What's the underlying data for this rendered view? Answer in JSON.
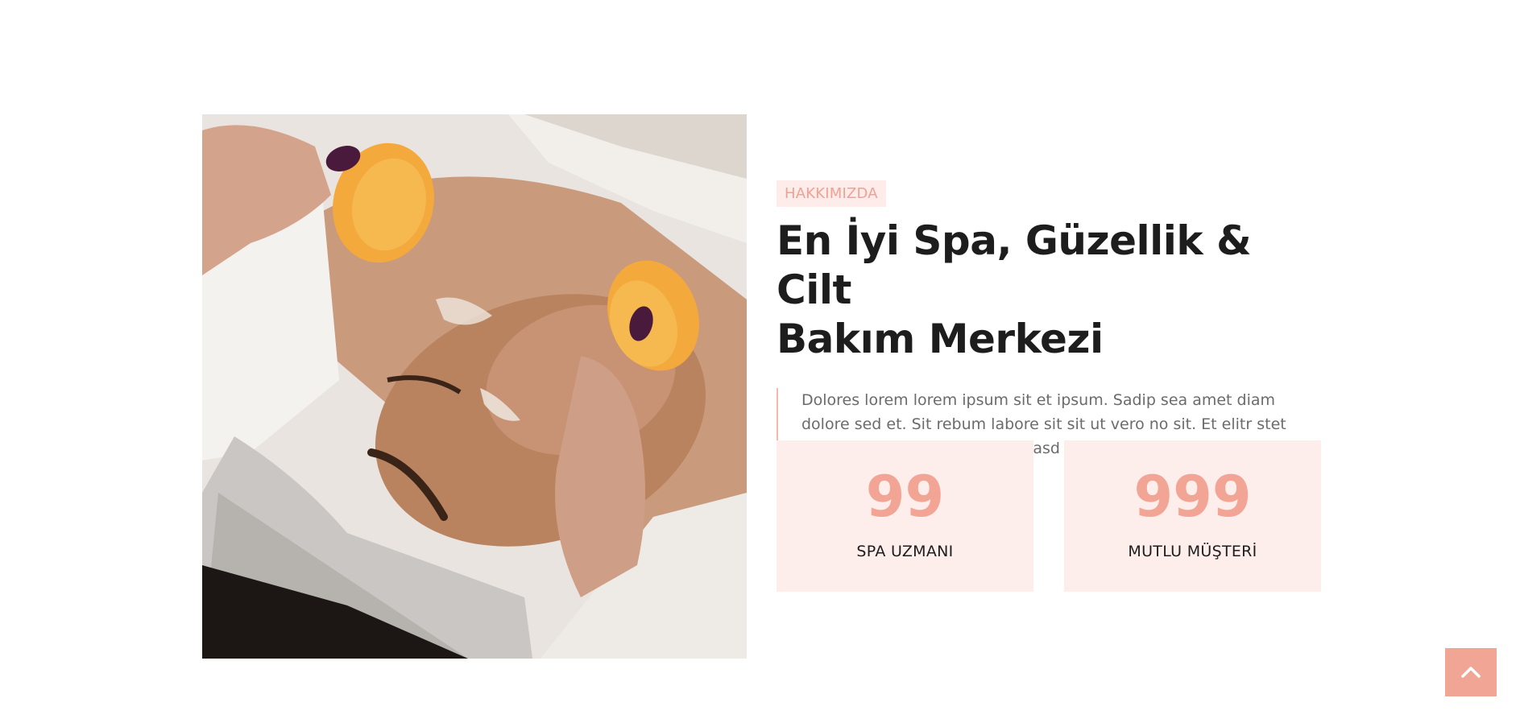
{
  "about": {
    "badge": "HAKKIMIZDA",
    "title_line1": "En İyi Spa, Güzellik & Cilt",
    "title_line2": "Bakım Merkezi",
    "description": "Dolores lorem lorem ipsum sit et ipsum. Sadip sea amet diam dolore sed et. Sit rebum labore sit sit ut vero no sit. Et elitr stet dolor sed sit et sed ipsum et kasd erat duo eos et erat"
  },
  "stats": [
    {
      "value": "99",
      "label": "SPA UZMANI"
    },
    {
      "value": "999",
      "label": "MUTLU MÜŞTERİ"
    }
  ],
  "back_to_top": {
    "icon": "chevron-up-icon"
  },
  "colors": {
    "accent": "#f2a594",
    "badge_bg": "#fdecea",
    "stat_bg": "#fdeeec",
    "heading": "#1d1d1d",
    "text": "#6b6b6b"
  }
}
